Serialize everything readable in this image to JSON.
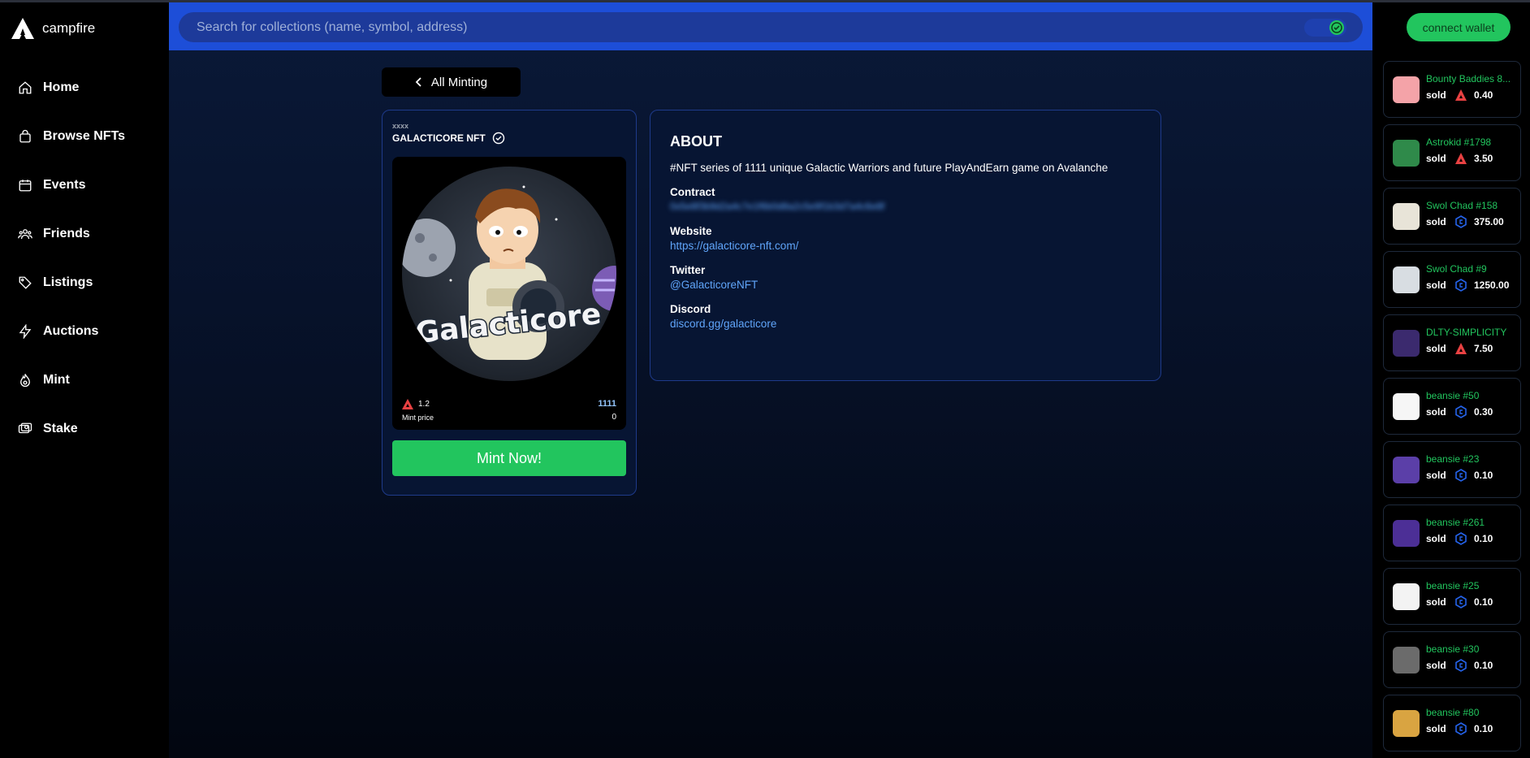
{
  "app": {
    "name": "campfire"
  },
  "nav": [
    {
      "label": "Home",
      "icon": "home-icon"
    },
    {
      "label": "Browse NFTs",
      "icon": "bag-icon"
    },
    {
      "label": "Events",
      "icon": "calendar-icon"
    },
    {
      "label": "Friends",
      "icon": "users-icon"
    },
    {
      "label": "Listings",
      "icon": "tag-icon"
    },
    {
      "label": "Auctions",
      "icon": "bolt-icon"
    },
    {
      "label": "Mint",
      "icon": "fire-icon"
    },
    {
      "label": "Stake",
      "icon": "stake-icon"
    }
  ],
  "search": {
    "placeholder": "Search for collections (name, symbol, address)"
  },
  "back": {
    "label": "All Minting"
  },
  "collection": {
    "creator": "xxxx",
    "name": "GALACTICORE NFT",
    "art_text": "Galacticore",
    "mint_price": "1.2",
    "mint_price_label": "Mint price",
    "supply": "1111",
    "minted": "0",
    "mint_button": "Mint Now!"
  },
  "about": {
    "heading": "ABOUT",
    "description": "#NFT series of 1111 unique Galactic Warriors and future PlayAndEarn game on Avalanche",
    "contract_label": "Contract",
    "contract_value": "0x5e8f3b9d2a4c7e1f6b0d8a2c5e9f1b3d7a4c6e8f",
    "website_label": "Website",
    "website_value": "https://galacticore-nft.com/",
    "twitter_label": "Twitter",
    "twitter_value": "@GalacticoreNFT",
    "discord_label": "Discord",
    "discord_value": "discord.gg/galacticore"
  },
  "wallet": {
    "label": "connect wallet"
  },
  "colors": {
    "accent_green": "#22c55e",
    "search_blue": "#1d4ed8",
    "link": "#60a5fa",
    "avax_red": "#e84142"
  },
  "sales": [
    {
      "name": "Bounty Baddies 8...",
      "status": "sold",
      "coin": "avax-icon",
      "price": "0.40",
      "thumb": "#f4a3a8"
    },
    {
      "name": "Astrokid #1798",
      "status": "sold",
      "coin": "avax-icon",
      "price": "3.50",
      "thumb": "#2f8a4a"
    },
    {
      "name": "Swol Chad #158",
      "status": "sold",
      "coin": "cro-icon",
      "price": "375.00",
      "thumb": "#e8e4d8"
    },
    {
      "name": "Swol Chad #9",
      "status": "sold",
      "coin": "cro-icon",
      "price": "1250.00",
      "thumb": "#d8dde2"
    },
    {
      "name": "DLTY-SIMPLICITY",
      "status": "sold",
      "coin": "avax-icon",
      "price": "7.50",
      "thumb": "#3b2a6e"
    },
    {
      "name": "beansie #50",
      "status": "sold",
      "coin": "cro-icon",
      "price": "0.30",
      "thumb": "#f6f6f6"
    },
    {
      "name": "beansie #23",
      "status": "sold",
      "coin": "cro-icon",
      "price": "0.10",
      "thumb": "#5b3fa8"
    },
    {
      "name": "beansie #261",
      "status": "sold",
      "coin": "cro-icon",
      "price": "0.10",
      "thumb": "#4c2f96"
    },
    {
      "name": "beansie #25",
      "status": "sold",
      "coin": "cro-icon",
      "price": "0.10",
      "thumb": "#f3f3f3"
    },
    {
      "name": "beansie #30",
      "status": "sold",
      "coin": "cro-icon",
      "price": "0.10",
      "thumb": "#6b6b6b"
    },
    {
      "name": "beansie #80",
      "status": "sold",
      "coin": "cro-icon",
      "price": "0.10",
      "thumb": "#d9a441"
    }
  ]
}
